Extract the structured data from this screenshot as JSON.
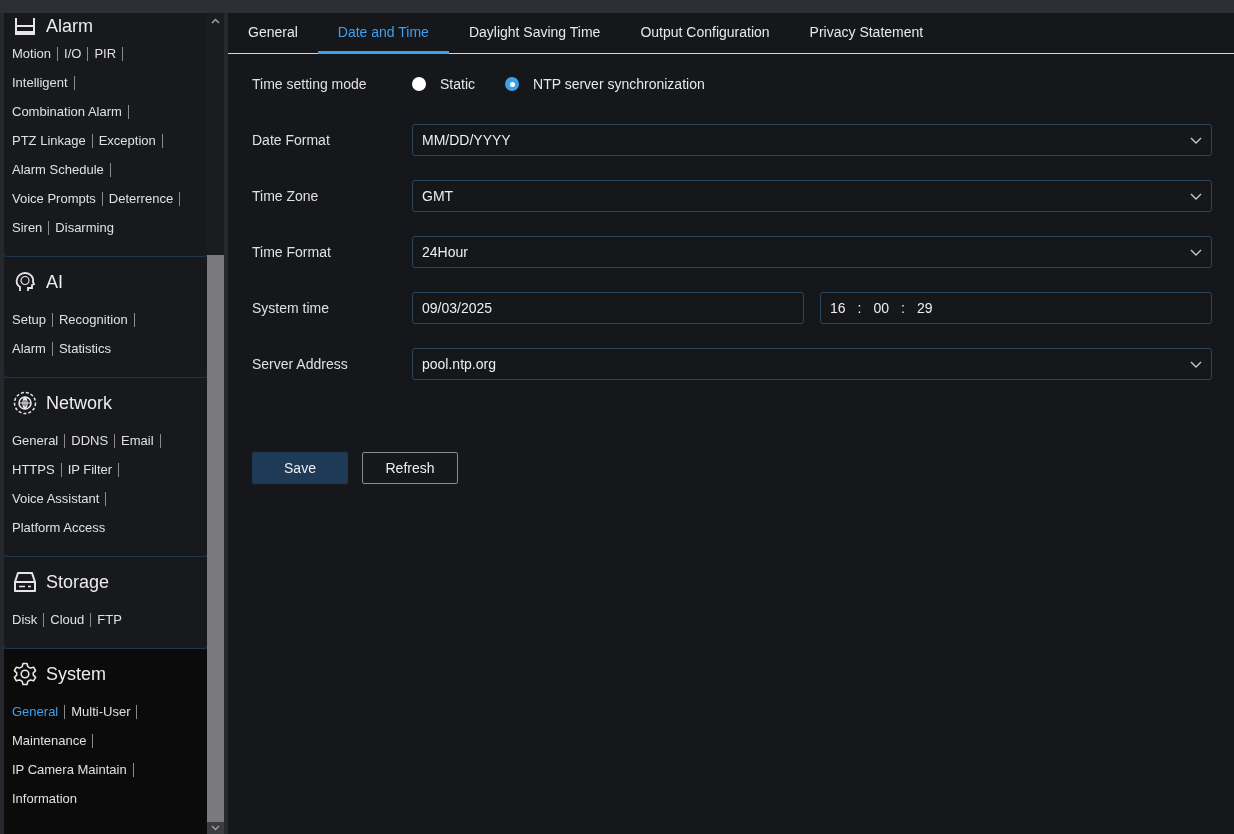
{
  "sidebar": {
    "sections": [
      {
        "title": "Alarm",
        "kind": "alarm",
        "selected": false,
        "rows": [
          [
            {
              "label": "Motion",
              "selected": false
            },
            {
              "label": "I/O",
              "selected": false
            },
            {
              "label": "PIR",
              "selected": false
            }
          ],
          [
            {
              "label": "Intelligent",
              "selected": false
            }
          ],
          [
            {
              "label": "Combination Alarm",
              "selected": false
            }
          ],
          [
            {
              "label": "PTZ Linkage",
              "selected": false
            },
            {
              "label": "Exception",
              "selected": false
            }
          ],
          [
            {
              "label": "Alarm Schedule",
              "selected": false
            }
          ],
          [
            {
              "label": "Voice Prompts",
              "selected": false
            },
            {
              "label": "Deterrence",
              "selected": false
            }
          ],
          [
            {
              "label": "Siren",
              "selected": false
            },
            {
              "label": "Disarming",
              "selected": false
            }
          ]
        ]
      },
      {
        "title": "AI",
        "kind": "ai",
        "selected": false,
        "rows": [
          [
            {
              "label": "Setup",
              "selected": false
            },
            {
              "label": "Recognition",
              "selected": false
            }
          ],
          [
            {
              "label": "Alarm",
              "selected": false
            },
            {
              "label": "Statistics",
              "selected": false
            }
          ]
        ]
      },
      {
        "title": "Network",
        "kind": "network",
        "selected": false,
        "rows": [
          [
            {
              "label": "General",
              "selected": false
            },
            {
              "label": "DDNS",
              "selected": false
            },
            {
              "label": "Email",
              "selected": false
            }
          ],
          [
            {
              "label": "HTTPS",
              "selected": false
            },
            {
              "label": "IP Filter",
              "selected": false
            }
          ],
          [
            {
              "label": "Voice Assistant",
              "selected": false
            }
          ],
          [
            {
              "label": "Platform Access",
              "selected": false
            }
          ]
        ]
      },
      {
        "title": "Storage",
        "kind": "storage",
        "selected": false,
        "rows": [
          [
            {
              "label": "Disk",
              "selected": false
            },
            {
              "label": "Cloud",
              "selected": false
            },
            {
              "label": "FTP",
              "selected": false
            }
          ]
        ]
      },
      {
        "title": "System",
        "kind": "system",
        "selected": true,
        "rows": [
          [
            {
              "label": "General",
              "selected": true
            },
            {
              "label": "Multi-User",
              "selected": false
            }
          ],
          [
            {
              "label": "Maintenance",
              "selected": false
            }
          ],
          [
            {
              "label": "IP Camera Maintain",
              "selected": false
            }
          ],
          [
            {
              "label": "Information",
              "selected": false
            }
          ]
        ]
      }
    ]
  },
  "tabs": [
    {
      "label": "General",
      "selected": false
    },
    {
      "label": "Date and Time",
      "selected": true
    },
    {
      "label": "Daylight Saving Time",
      "selected": false
    },
    {
      "label": "Output Configuration",
      "selected": false
    },
    {
      "label": "Privacy Statement",
      "selected": false
    }
  ],
  "form": {
    "time_setting_mode": {
      "label": "Time setting mode",
      "options": [
        {
          "label": "Static",
          "selected": false
        },
        {
          "label": "NTP server synchronization",
          "selected": true
        }
      ]
    },
    "fields": [
      {
        "kind": "select",
        "label": "Date Format",
        "value": "MM/DD/YYYY"
      },
      {
        "kind": "select",
        "label": "Time Zone",
        "value": "GMT"
      },
      {
        "kind": "select",
        "label": "Time Format",
        "value": "24Hour"
      },
      {
        "kind": "datetime",
        "label": "System time",
        "value": "09/03/2025",
        "time_parts": [
          "16",
          ":",
          "00",
          ":",
          "29"
        ]
      },
      {
        "kind": "select",
        "label": "Server Address",
        "value": "pool.ntp.org"
      }
    ]
  },
  "buttons": [
    {
      "label": "Save",
      "kind": "primary"
    },
    {
      "label": "Refresh",
      "kind": "secondary"
    }
  ]
}
